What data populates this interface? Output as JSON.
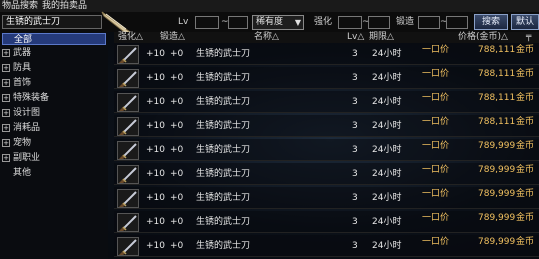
{
  "tabs": [
    "物品搜索",
    "我的拍卖品"
  ],
  "search": {
    "item_name": "生锈的武士刀",
    "level_label": "Lv",
    "level_sep": "~",
    "rarity_select": "稀有度",
    "enhance_label": "强化",
    "enhance_sep": "~",
    "forge_label": "锻造",
    "forge_sep": "~",
    "search_button": "搜索",
    "default_button": "默认"
  },
  "categories": [
    {
      "label": "全部",
      "expander": ""
    },
    {
      "label": "武器",
      "expander": "+"
    },
    {
      "label": "防具",
      "expander": "+"
    },
    {
      "label": "首饰",
      "expander": "+"
    },
    {
      "label": "特殊装备",
      "expander": "+"
    },
    {
      "label": "设计图",
      "expander": "+"
    },
    {
      "label": "消耗品",
      "expander": "+"
    },
    {
      "label": "宠物",
      "expander": "+"
    },
    {
      "label": "副职业",
      "expander": "+"
    },
    {
      "label": "其他",
      "expander": ""
    }
  ],
  "columns": {
    "enhance": "强化△",
    "forge": "锻造△",
    "name": "名称△",
    "level": "Lv△",
    "period": "期限△",
    "price": "价格(金币)△",
    "pin": "╤"
  },
  "rows": [
    {
      "enhance": "+10",
      "forge": "+0",
      "name": "生锈的武士刀",
      "level": "3",
      "period": "24小时",
      "buytype": "一口价",
      "price": "788,111",
      "unit": "金币"
    },
    {
      "enhance": "+10",
      "forge": "+0",
      "name": "生锈的武士刀",
      "level": "3",
      "period": "24小时",
      "buytype": "一口价",
      "price": "788,111",
      "unit": "金币"
    },
    {
      "enhance": "+10",
      "forge": "+0",
      "name": "生锈的武士刀",
      "level": "3",
      "period": "24小时",
      "buytype": "一口价",
      "price": "788,111",
      "unit": "金币"
    },
    {
      "enhance": "+10",
      "forge": "+0",
      "name": "生锈的武士刀",
      "level": "3",
      "period": "24小时",
      "buytype": "一口价",
      "price": "788,111",
      "unit": "金币"
    },
    {
      "enhance": "+10",
      "forge": "+0",
      "name": "生锈的武士刀",
      "level": "3",
      "period": "24小时",
      "buytype": "一口价",
      "price": "789,999",
      "unit": "金币"
    },
    {
      "enhance": "+10",
      "forge": "+0",
      "name": "生锈的武士刀",
      "level": "3",
      "period": "24小时",
      "buytype": "一口价",
      "price": "789,999",
      "unit": "金币"
    },
    {
      "enhance": "+10",
      "forge": "+0",
      "name": "生锈的武士刀",
      "level": "3",
      "period": "24小时",
      "buytype": "一口价",
      "price": "789,999",
      "unit": "金币"
    },
    {
      "enhance": "+10",
      "forge": "+0",
      "name": "生锈的武士刀",
      "level": "3",
      "period": "24小时",
      "buytype": "一口价",
      "price": "789,999",
      "unit": "金币"
    },
    {
      "enhance": "+10",
      "forge": "+0",
      "name": "生锈的武士刀",
      "level": "3",
      "period": "24小时",
      "buytype": "一口价",
      "price": "789,999",
      "unit": "金币"
    }
  ],
  "colors": {
    "selected_category": "#253a7a",
    "price_text": "#f0c060",
    "button": "#2c3a5a"
  },
  "icons": {
    "item": "katana-icon",
    "search_decoration": "quill-icon"
  }
}
